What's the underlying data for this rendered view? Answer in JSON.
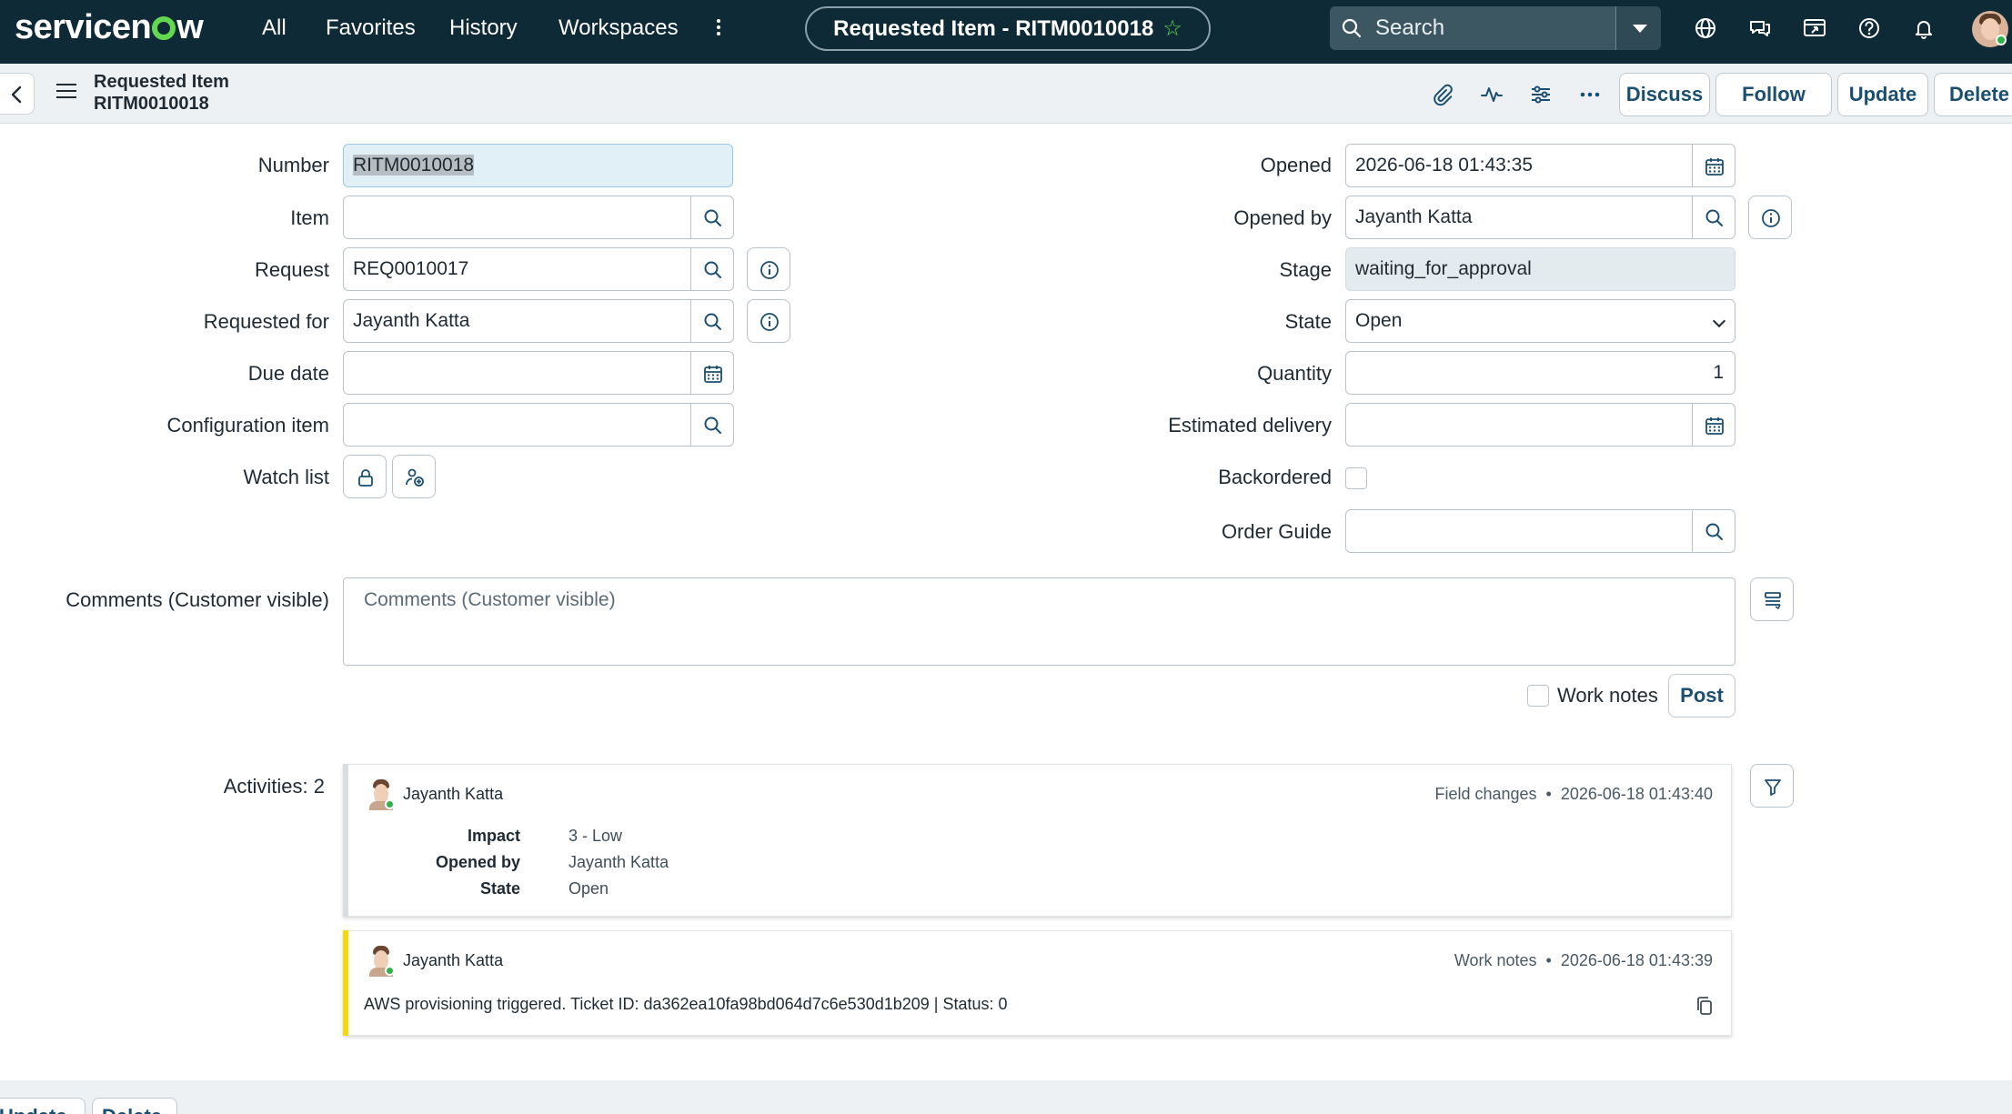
{
  "header": {
    "logo_text_before": "servicen",
    "logo_text_after": "w",
    "nav": [
      "All",
      "Favorites",
      "History",
      "Workspaces"
    ],
    "record_title": "Requested Item - RITM0010018",
    "search_placeholder": "Search",
    "icons": [
      "globe-icon",
      "chat-icon",
      "scripts-icon",
      "help-icon",
      "bell-icon",
      "user-avatar"
    ]
  },
  "form_header": {
    "title_line1": "Requested Item",
    "title_line2": "RITM0010018",
    "buttons": {
      "discuss": "Discuss",
      "follow": "Follow",
      "update": "Update",
      "delete": "Delete"
    }
  },
  "form": {
    "left": {
      "number": {
        "label": "Number",
        "value": "RITM0010018"
      },
      "item": {
        "label": "Item",
        "value": ""
      },
      "request": {
        "label": "Request",
        "value": "REQ0010017"
      },
      "requested_for": {
        "label": "Requested for",
        "value": "Jayanth Katta"
      },
      "due_date": {
        "label": "Due date",
        "value": ""
      },
      "configuration_item": {
        "label": "Configuration item",
        "value": ""
      },
      "watch_list": {
        "label": "Watch list"
      }
    },
    "right": {
      "opened": {
        "label": "Opened",
        "value": "2026-06-18 01:43:35"
      },
      "opened_by": {
        "label": "Opened by",
        "value": "Jayanth Katta"
      },
      "stage": {
        "label": "Stage",
        "value": "waiting_for_approval"
      },
      "state": {
        "label": "State",
        "value": "Open"
      },
      "quantity": {
        "label": "Quantity",
        "value": "1"
      },
      "estimated_delivery": {
        "label": "Estimated delivery",
        "value": ""
      },
      "backordered": {
        "label": "Backordered",
        "checked": false
      },
      "order_guide": {
        "label": "Order Guide",
        "value": ""
      }
    },
    "comments": {
      "label": "Comments (Customer visible)",
      "placeholder": "Comments (Customer visible)"
    },
    "work_notes_label": "Work notes",
    "post_label": "Post"
  },
  "activities": {
    "label": "Activities: 2",
    "entries": [
      {
        "user": "Jayanth Katta",
        "type": "Field changes",
        "timestamp": "2026-06-18 01:43:40",
        "fields": [
          {
            "label": "Impact",
            "value": "3 - Low"
          },
          {
            "label": "Opened by",
            "value": "Jayanth Katta"
          },
          {
            "label": "State",
            "value": "Open"
          }
        ],
        "accent": "#d8dde0"
      },
      {
        "user": "Jayanth Katta",
        "type": "Work notes",
        "timestamp": "2026-06-18 01:43:39",
        "text": "AWS provisioning triggered. Ticket ID: da362ea10fa98bd064d7c6e530d1b209 | Status: 0",
        "accent": "#f5d90a"
      }
    ]
  },
  "bottom_buttons": {
    "update": "Update",
    "delete": "Delete"
  },
  "colors": {
    "header_bg": "#0e2a36",
    "brand_green": "#62d84e",
    "button_text": "#1b4f72",
    "work_notes_accent": "#f5d90a"
  }
}
